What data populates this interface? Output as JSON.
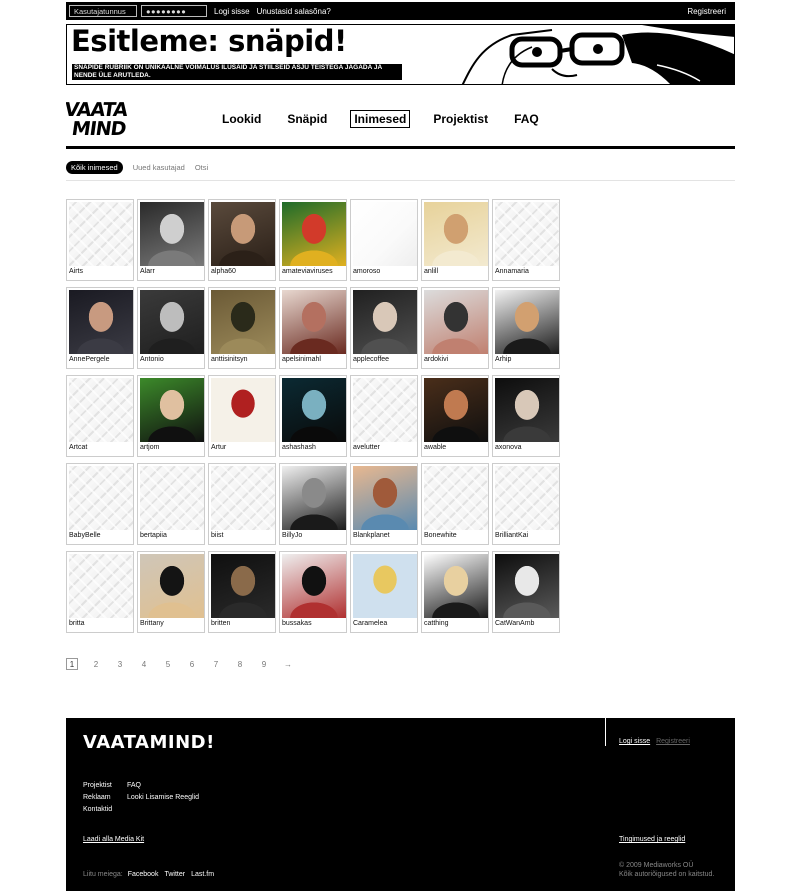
{
  "topbar": {
    "username_placeholder": "Kasutajatunnus",
    "password_value": "●●●●●●●●",
    "login_label": "Logi sisse",
    "forgot_label": "Unustasid salasõna?",
    "register_label": "Registreeri"
  },
  "banner": {
    "title": "Esitleme: snäpid!",
    "subtitle": "Snäpide rubriik on unikaalne võimalus ilusaid ja stiilseid asju teistega jagada ja nende üle arutleda."
  },
  "logo": {
    "line1": "VAATA",
    "line2": "MIND"
  },
  "nav": {
    "items": [
      {
        "label": "Lookid",
        "active": false
      },
      {
        "label": "Snäpid",
        "active": false
      },
      {
        "label": "Inimesed",
        "active": true
      },
      {
        "label": "Projektist",
        "active": false
      },
      {
        "label": "FAQ",
        "active": false
      }
    ]
  },
  "subnav": {
    "all_label": "Kõik inimesed",
    "new_label": "Uued kasutajad",
    "search_label": "Otsi"
  },
  "users": [
    {
      "name": "Airts",
      "photo": "default",
      "colors": []
    },
    {
      "name": "Alarr",
      "photo": "portrait",
      "colors": [
        "#2a2a2a",
        "#cfcfcf",
        "#7a7a7a"
      ]
    },
    {
      "name": "alpha60",
      "photo": "portrait",
      "colors": [
        "#5a4a3c",
        "#c79a78",
        "#2b2018"
      ]
    },
    {
      "name": "amateviaviruses",
      "photo": "portrait",
      "colors": [
        "#1e6b2a",
        "#d23a2a",
        "#e0b020"
      ]
    },
    {
      "name": "amoroso",
      "photo": "blank",
      "colors": []
    },
    {
      "name": "anlill",
      "photo": "portrait",
      "colors": [
        "#e7d29a",
        "#d0a070",
        "#f3ead0"
      ]
    },
    {
      "name": "Annamaria",
      "photo": "default",
      "colors": []
    },
    {
      "name": "AnnePergele",
      "photo": "portrait",
      "colors": [
        "#1a1a22",
        "#c89a80",
        "#3b3b44"
      ]
    },
    {
      "name": "Antonio",
      "photo": "portrait",
      "colors": [
        "#3a3a3a",
        "#bdbdbd",
        "#1f1f1f"
      ]
    },
    {
      "name": "anttisinitsyn",
      "photo": "portrait",
      "colors": [
        "#6b5a36",
        "#2a2a1a",
        "#9c8a5a"
      ]
    },
    {
      "name": "apelsinimahl",
      "photo": "portrait",
      "colors": [
        "#e8d8d0",
        "#b47060",
        "#6a2a20"
      ]
    },
    {
      "name": "applecoffee",
      "photo": "portrait",
      "colors": [
        "#202020",
        "#d9c8b8",
        "#505050"
      ]
    },
    {
      "name": "ardokivi",
      "photo": "portrait",
      "colors": [
        "#dcdcdc",
        "#333333",
        "#c08070"
      ]
    },
    {
      "name": "Arhip",
      "photo": "portrait",
      "colors": [
        "#f2f2f2",
        "#d2a070",
        "#1a1a1a"
      ]
    },
    {
      "name": "Artcat",
      "photo": "default",
      "colors": []
    },
    {
      "name": "artjom",
      "photo": "portrait",
      "colors": [
        "#3c8a2a",
        "#e0c0a0",
        "#101010"
      ]
    },
    {
      "name": "Artur",
      "photo": "sketch",
      "colors": [
        "#f5f1e8",
        "#b02020",
        "#6a5a4a"
      ]
    },
    {
      "name": "ashashash",
      "photo": "portrait",
      "colors": [
        "#0b2a33",
        "#7ab0c0",
        "#0a0a0a"
      ]
    },
    {
      "name": "avelutter",
      "photo": "default",
      "colors": []
    },
    {
      "name": "awable",
      "photo": "portrait",
      "colors": [
        "#4a2e1a",
        "#c07a50",
        "#0f0f0f"
      ]
    },
    {
      "name": "axonova",
      "photo": "portrait",
      "colors": [
        "#0d0d0d",
        "#d8c8b8",
        "#3a3a3a"
      ]
    },
    {
      "name": "BabyBelle",
      "photo": "default",
      "colors": []
    },
    {
      "name": "bertapiia",
      "photo": "default",
      "colors": []
    },
    {
      "name": "biist",
      "photo": "default",
      "colors": []
    },
    {
      "name": "BillyJo",
      "photo": "portrait",
      "colors": [
        "#f0f0f0",
        "#8a8a8a",
        "#1a1a1a"
      ]
    },
    {
      "name": "Blankplanet",
      "photo": "portrait",
      "colors": [
        "#e8b890",
        "#a05a3a",
        "#5a8ab0"
      ]
    },
    {
      "name": "Bonewhite",
      "photo": "default",
      "colors": []
    },
    {
      "name": "BrilliantKai",
      "photo": "default",
      "colors": []
    },
    {
      "name": "britta",
      "photo": "default",
      "colors": []
    },
    {
      "name": "Brittany",
      "photo": "portrait",
      "colors": [
        "#cfc6b8",
        "#141414",
        "#e0c090"
      ]
    },
    {
      "name": "britten",
      "photo": "portrait",
      "colors": [
        "#0f0f0f",
        "#8a6a4a",
        "#2a2a2a"
      ]
    },
    {
      "name": "bussakas",
      "photo": "portrait",
      "colors": [
        "#efefef",
        "#111111",
        "#b03030"
      ]
    },
    {
      "name": "Caramelea",
      "photo": "sketch",
      "colors": [
        "#cfe0ee",
        "#e8c860",
        "#c04030"
      ]
    },
    {
      "name": "catthing",
      "photo": "portrait",
      "colors": [
        "#ffffff",
        "#e8d0a0",
        "#1a1a1a"
      ]
    },
    {
      "name": "CatWanAmb",
      "photo": "portrait",
      "colors": [
        "#0d0d0d",
        "#e8e8e8",
        "#5a5a5a"
      ]
    }
  ],
  "pager": {
    "pages": [
      "1",
      "2",
      "3",
      "4",
      "5",
      "6",
      "7",
      "8",
      "9"
    ],
    "current": "1",
    "next": "→"
  },
  "footer": {
    "brand": "VAATAMIND!",
    "login_label": "Logi sisse",
    "register_label": "Registreeri",
    "links_col1": [
      "Projektist",
      "Reklaam",
      "Kontaktid"
    ],
    "links_col2": [
      "FAQ",
      "Looki Lisamise Reeglid"
    ],
    "media_kit": "Laadi alla Media Kit",
    "terms": "Tingimused ja reeglid",
    "join_label": "Liitu meiega:",
    "social": [
      "Facebook",
      "Twitter",
      "Last.fm"
    ],
    "copyright_1": "© 2009 Mediaworks OÜ",
    "copyright_2": "Kõik autoriõigused on kaitstud."
  }
}
